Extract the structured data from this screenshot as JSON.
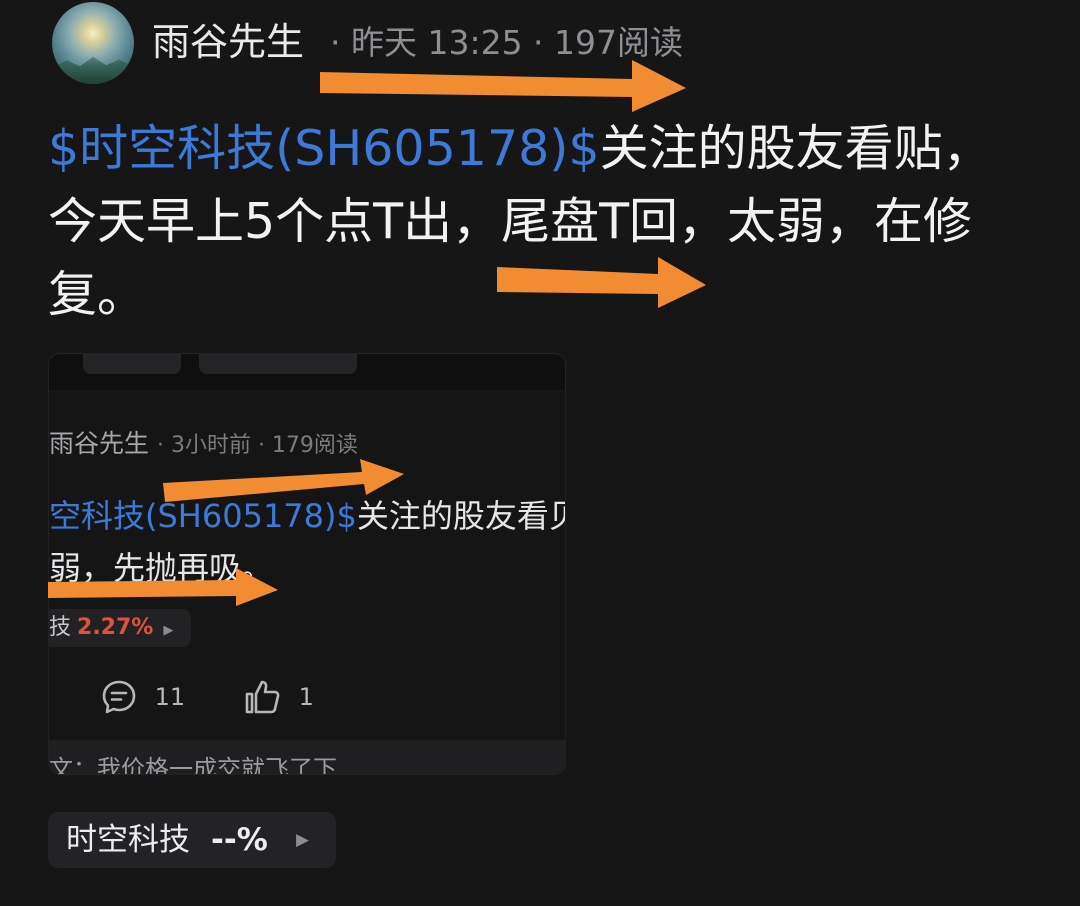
{
  "post": {
    "author": "雨谷先生",
    "meta": "· 昨天 13:25 · 197阅读",
    "tag": "$时空科技(SH605178)$",
    "text_line1": "关注的股友看贴，",
    "text_line2": "今天早上5个点T出，尾盘T回，太弱，在修",
    "text_line3": "复。"
  },
  "embedded": {
    "author": "雨谷先生",
    "meta": "· 3小时前 · 179阅读",
    "line1_tag": "空科技(SH605178)$",
    "line1_text": "关注的股友看贝",
    "line2": "弱，先抛再吸。",
    "stock_name": "技",
    "stock_pct": "2.27%",
    "comments": "11",
    "likes": "1",
    "bottom_text": "文：我价格一成交就飞了下"
  },
  "stock_chip": {
    "name": "时空科技",
    "pct": "--%"
  },
  "colors": {
    "background": "#161617",
    "tag_blue": "#3d7ad8",
    "arrow_orange": "#f28c33",
    "pct_red": "#e0513f"
  },
  "icons": [
    "avatar",
    "comment-icon",
    "thumbs-up-icon",
    "play-triangle-icon",
    "arrow-annotation"
  ]
}
